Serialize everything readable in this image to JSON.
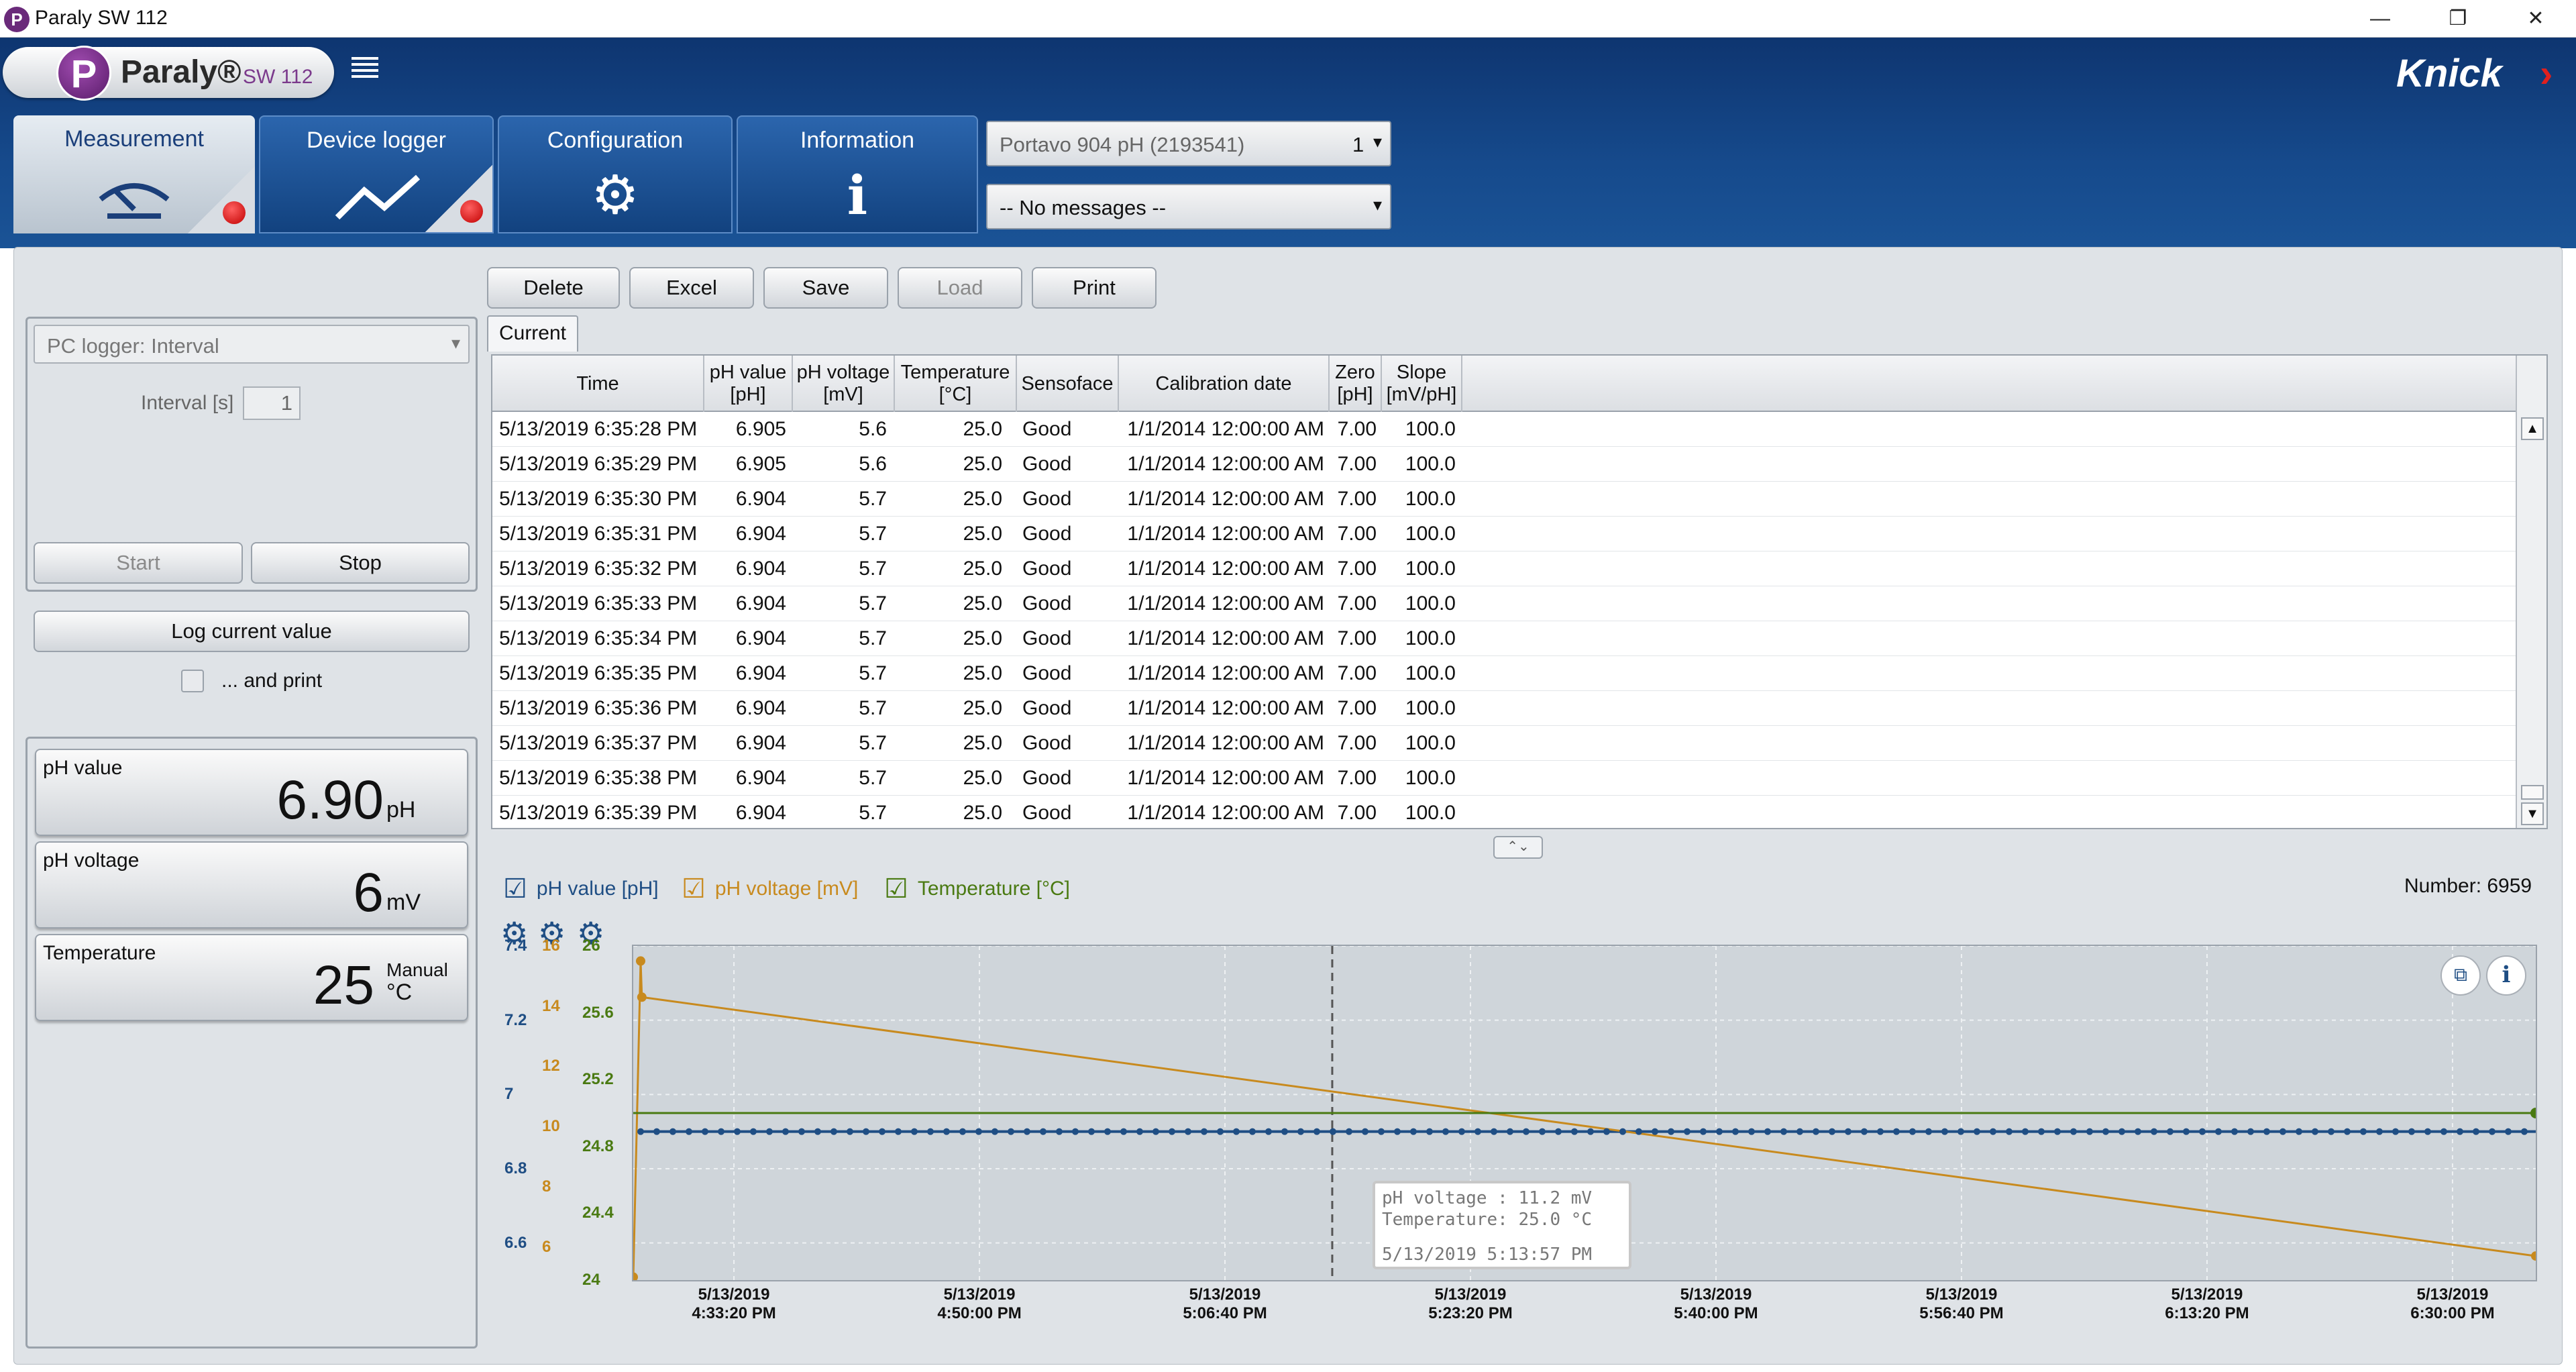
{
  "window": {
    "title": "Paraly SW 112",
    "minimize": "—",
    "restore": "❐",
    "close": "✕"
  },
  "header": {
    "logo_name": "Paraly®",
    "logo_version": "SW 112",
    "brand": "Knick",
    "brand_mark": "›",
    "tabs": [
      {
        "label": "Measurement",
        "icon": "gauge-icon",
        "glyph": "⌒"
      },
      {
        "label": "Device logger",
        "icon": "trend-line-icon",
        "glyph": "〽"
      },
      {
        "label": "Configuration",
        "icon": "gear-icon",
        "glyph": "⚙"
      },
      {
        "label": "Information",
        "icon": "info-icon",
        "glyph": "ℹ"
      }
    ],
    "device_select": {
      "value": "Portavo 904 pH (2193541)",
      "channel": "1"
    },
    "messages_select": {
      "value": "-- No messages --"
    }
  },
  "left": {
    "logger_mode": "PC logger: Interval",
    "interval_label": "Interval [s]",
    "interval_value": "1",
    "start_label": "Start",
    "stop_label": "Stop",
    "log_current_label": "Log current value",
    "and_print_label": "... and print",
    "readouts": [
      {
        "label": "pH value",
        "value": "6.90",
        "unit": "pH",
        "mode": ""
      },
      {
        "label": "pH voltage",
        "value": "6",
        "unit": "mV",
        "mode": ""
      },
      {
        "label": "Temperature",
        "value": "25",
        "unit": "°C",
        "mode": "Manual"
      }
    ]
  },
  "toolbar": {
    "delete": "Delete",
    "excel": "Excel",
    "save": "Save",
    "load": "Load",
    "print": "Print"
  },
  "table": {
    "tab_label": "Current",
    "headers": [
      "Time",
      "pH value [pH]",
      "pH voltage [mV]",
      "Temperature [°C]",
      "Sensoface",
      "Calibration date",
      "Zero [pH]",
      "Slope [mV/pH]"
    ],
    "rows": [
      [
        "5/13/2019 6:35:28 PM",
        "6.905",
        "5.6",
        "25.0",
        "Good",
        "1/1/2014 12:00:00 AM",
        "7.00",
        "100.0"
      ],
      [
        "5/13/2019 6:35:29 PM",
        "6.905",
        "5.6",
        "25.0",
        "Good",
        "1/1/2014 12:00:00 AM",
        "7.00",
        "100.0"
      ],
      [
        "5/13/2019 6:35:30 PM",
        "6.904",
        "5.7",
        "25.0",
        "Good",
        "1/1/2014 12:00:00 AM",
        "7.00",
        "100.0"
      ],
      [
        "5/13/2019 6:35:31 PM",
        "6.904",
        "5.7",
        "25.0",
        "Good",
        "1/1/2014 12:00:00 AM",
        "7.00",
        "100.0"
      ],
      [
        "5/13/2019 6:35:32 PM",
        "6.904",
        "5.7",
        "25.0",
        "Good",
        "1/1/2014 12:00:00 AM",
        "7.00",
        "100.0"
      ],
      [
        "5/13/2019 6:35:33 PM",
        "6.904",
        "5.7",
        "25.0",
        "Good",
        "1/1/2014 12:00:00 AM",
        "7.00",
        "100.0"
      ],
      [
        "5/13/2019 6:35:34 PM",
        "6.904",
        "5.7",
        "25.0",
        "Good",
        "1/1/2014 12:00:00 AM",
        "7.00",
        "100.0"
      ],
      [
        "5/13/2019 6:35:35 PM",
        "6.904",
        "5.7",
        "25.0",
        "Good",
        "1/1/2014 12:00:00 AM",
        "7.00",
        "100.0"
      ],
      [
        "5/13/2019 6:35:36 PM",
        "6.904",
        "5.7",
        "25.0",
        "Good",
        "1/1/2014 12:00:00 AM",
        "7.00",
        "100.0"
      ],
      [
        "5/13/2019 6:35:37 PM",
        "6.904",
        "5.7",
        "25.0",
        "Good",
        "1/1/2014 12:00:00 AM",
        "7.00",
        "100.0"
      ],
      [
        "5/13/2019 6:35:38 PM",
        "6.904",
        "5.7",
        "25.0",
        "Good",
        "1/1/2014 12:00:00 AM",
        "7.00",
        "100.0"
      ],
      [
        "5/13/2019 6:35:39 PM",
        "6.904",
        "5.7",
        "25.0",
        "Good",
        "1/1/2014 12:00:00 AM",
        "7.00",
        "100.0"
      ]
    ]
  },
  "chart": {
    "legend": [
      {
        "label": "pH value [pH]",
        "color": "#1f4e84"
      },
      {
        "label": "pH voltage [mV]",
        "color": "#c88a1e"
      },
      {
        "label": "Temperature [°C]",
        "color": "#4a7a12"
      }
    ],
    "number_label": "Number: 6959",
    "tooltip": {
      "line1": "pH voltage : 11.2 mV",
      "line2": "Temperature: 25.0 °C",
      "line3": "5/13/2019 5:13:57 PM"
    }
  },
  "chart_data": {
    "type": "line",
    "x_ticks": [
      [
        "5/13/2019",
        "4:33:20 PM"
      ],
      [
        "5/13/2019",
        "4:50:00 PM"
      ],
      [
        "5/13/2019",
        "5:06:40 PM"
      ],
      [
        "5/13/2019",
        "5:23:20 PM"
      ],
      [
        "5/13/2019",
        "5:40:00 PM"
      ],
      [
        "5/13/2019",
        "5:56:40 PM"
      ],
      [
        "5/13/2019",
        "6:13:20 PM"
      ],
      [
        "5/13/2019",
        "6:30:00 PM"
      ]
    ],
    "xlim": [
      "5/13/2019 4:26:30 PM",
      "5/13/2019 6:35:39 PM"
    ],
    "axes": [
      {
        "name": "pH",
        "ticks": [
          "7.4",
          "7.2",
          "7",
          "6.8",
          "6.6"
        ],
        "ylim": [
          6.5,
          7.4
        ],
        "color": "#1f4e84"
      },
      {
        "name": "mV",
        "ticks": [
          "16",
          "14",
          "12",
          "10",
          "8",
          "6"
        ],
        "ylim": [
          4.9,
          16
        ],
        "color": "#c88a1e"
      },
      {
        "name": "°C",
        "ticks": [
          "26",
          "25.6",
          "25.2",
          "24.8",
          "24.4",
          "24"
        ],
        "ylim": [
          24,
          26
        ],
        "color": "#4a7a12"
      }
    ],
    "series": [
      {
        "name": "pH value [pH]",
        "x": [
          "4:27:00 PM",
          "6:35:39 PM"
        ],
        "values": [
          6.9,
          6.9
        ]
      },
      {
        "name": "pH voltage [mV]",
        "x": [
          "4:26:30 PM",
          "4:27:00 PM",
          "4:27:05 PM",
          "6:35:39 PM"
        ],
        "values": [
          5.0,
          15.5,
          14.3,
          5.7
        ]
      },
      {
        "name": "Temperature [°C]",
        "x": [
          "4:26:30 PM",
          "6:35:39 PM"
        ],
        "values": [
          25.0,
          25.0
        ]
      }
    ],
    "crosshair_x": "5:13:57 PM",
    "grid": true
  }
}
